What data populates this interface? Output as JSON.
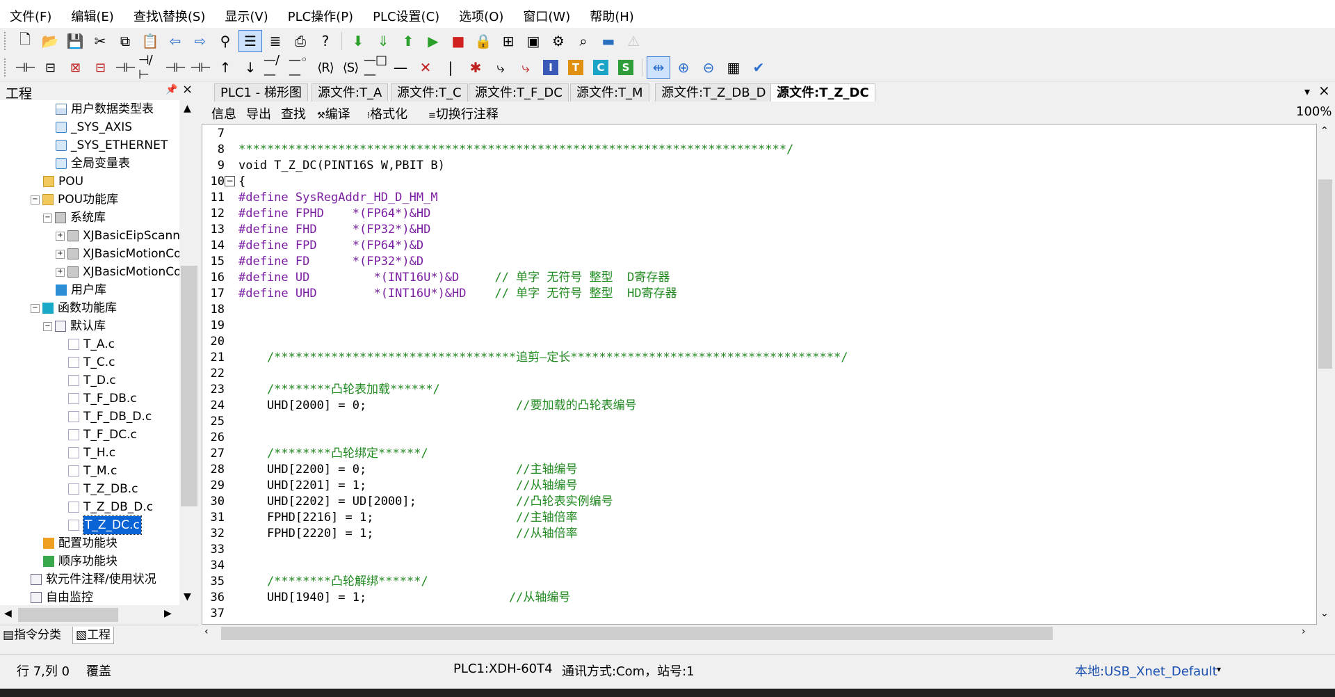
{
  "menu": [
    "文件(F)",
    "编辑(E)",
    "查找\\替换(S)",
    "显示(V)",
    "PLC操作(P)",
    "PLC设置(C)",
    "选项(O)",
    "窗口(W)",
    "帮助(H)"
  ],
  "left_panel": {
    "title": "工程",
    "pin": "ᵖ",
    "close": "×",
    "tree": [
      "用户数据类型表",
      "_SYS_AXIS",
      "_SYS_ETHERNET",
      "全局变量表",
      "POU",
      "POU功能库",
      "系统库",
      "XJBasicEipScann",
      "XJBasicMotionCor",
      "XJBasicMotionCor",
      "用户库",
      "函数功能库",
      "默认库",
      "T_A.c",
      "T_C.c",
      "T_D.c",
      "T_F_DB.c",
      "T_F_DB_D.c",
      "T_F_DC.c",
      "T_H.c",
      "T_M.c",
      "T_Z_DB.c",
      "T_Z_DB_D.c",
      "T_Z_DC.c",
      "配置功能块",
      "顺序功能块",
      "软元件注释/使用状况",
      "自由监控"
    ],
    "tabs": [
      "指令分类",
      "工程"
    ]
  },
  "doc_tabs": [
    "PLC1 - 梯形图",
    "源文件:T_A",
    "源文件:T_C",
    "源文件:T_F_DC",
    "源文件:T_M",
    "源文件:T_Z_DB_D",
    "源文件:T_Z_DC"
  ],
  "doc_close": "×",
  "doc_menu": "▾",
  "edit_toolbar": {
    "info": "信息",
    "export": "导出",
    "find": "查找",
    "compile": "编译",
    "format": "格式化",
    "toggle_comment": "切换行注释",
    "zoom": "100%"
  },
  "code_lines": [
    {
      "n": "7",
      "t": ""
    },
    {
      "n": "8",
      "t": "*****************************************************************************/"
    },
    {
      "n": "9",
      "t": "void T_Z_DC(PINT16S W,PBIT B)"
    },
    {
      "n": "10",
      "t": "{"
    },
    {
      "n": "11",
      "t": "#define SysRegAddr_HD_D_HM_M"
    },
    {
      "n": "12",
      "t": "#define FPHD    *(FP64*)&HD"
    },
    {
      "n": "13",
      "t": "#define FHD     *(FP32*)&HD"
    },
    {
      "n": "14",
      "t": "#define FPD     *(FP64*)&D"
    },
    {
      "n": "15",
      "t": "#define FD      *(FP32*)&D"
    },
    {
      "n": "16",
      "t": "#define UD         *(INT16U*)&D     // 单字 无符号 整型  D寄存器"
    },
    {
      "n": "17",
      "t": "#define UHD        *(INT16U*)&HD    // 单字 无符号 整型  HD寄存器"
    },
    {
      "n": "18",
      "t": ""
    },
    {
      "n": "19",
      "t": ""
    },
    {
      "n": "20",
      "t": ""
    },
    {
      "n": "21",
      "t": "    /**********************************追剪—定长**************************************/"
    },
    {
      "n": "22",
      "t": ""
    },
    {
      "n": "23",
      "t": "    /********凸轮表加载******/"
    },
    {
      "n": "24",
      "t": "    UHD[2000] = 0;                     //要加载的凸轮表编号"
    },
    {
      "n": "25",
      "t": ""
    },
    {
      "n": "26",
      "t": ""
    },
    {
      "n": "27",
      "t": "    /********凸轮绑定******/"
    },
    {
      "n": "28",
      "t": "    UHD[2200] = 0;                     //主轴编号"
    },
    {
      "n": "29",
      "t": "    UHD[2201] = 1;                     //从轴编号"
    },
    {
      "n": "30",
      "t": "    UHD[2202] = UD[2000];              //凸轮表实例编号"
    },
    {
      "n": "31",
      "t": "    FPHD[2216] = 1;                    //主轴倍率"
    },
    {
      "n": "32",
      "t": "    FPHD[2220] = 1;                    //从轴倍率"
    },
    {
      "n": "33",
      "t": ""
    },
    {
      "n": "34",
      "t": ""
    },
    {
      "n": "35",
      "t": "    /********凸轮解绑******/"
    },
    {
      "n": "36",
      "t": "    UHD[1940] = 1;                    //从轴编号"
    },
    {
      "n": "37",
      "t": ""
    }
  ],
  "status": {
    "pos": "行 7,列 0",
    "mode": "覆盖",
    "plc": "PLC1:XDH-60T4",
    "comm": "通讯方式:Com，站号:1",
    "link": "本地:USB_Xnet_Default"
  },
  "colors": {
    "selection": "#0a64d6",
    "keyword_define": "#7b1fa2",
    "comment": "#228b22",
    "link": "#1a4fb0"
  }
}
